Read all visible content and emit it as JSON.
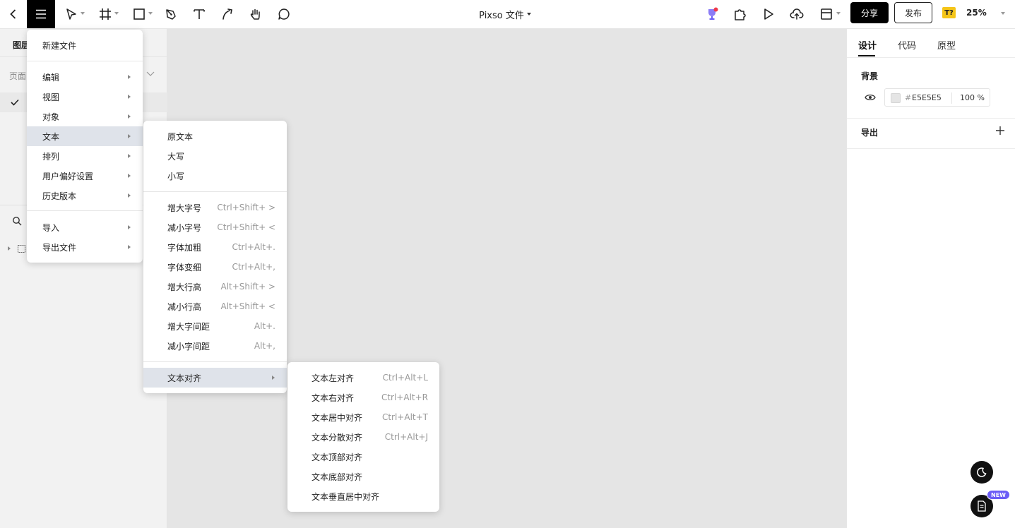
{
  "toolbar": {
    "title": "Pixso 文件",
    "share_label": "分享",
    "publish_label": "发布",
    "font_badge": "T?",
    "zoom": "25%",
    "icons": [
      "back-icon",
      "menu-icon",
      "move-tool-icon",
      "frame-tool-icon",
      "rectangle-tool-icon",
      "pen-tool-icon",
      "text-tool-icon",
      "pencil-tool-icon",
      "hand-tool-icon",
      "comment-tool-icon",
      "trophy-icon",
      "plugin-icon",
      "play-icon",
      "upload-icon",
      "layout-icon"
    ]
  },
  "left_panel": {
    "tab_label": "图层",
    "pages_label": "页面"
  },
  "right_panel": {
    "tabs": [
      {
        "label": "设计",
        "active": true
      },
      {
        "label": "代码",
        "active": false
      },
      {
        "label": "原型",
        "active": false
      }
    ],
    "background_label": "背景",
    "background_hash": "#",
    "background_hex": "E5E5E5",
    "background_opacity": "100 %",
    "export_label": "导出"
  },
  "main_menu": {
    "items": [
      {
        "label": "新建文件",
        "submenu": false
      },
      {
        "label": "编辑",
        "submenu": true
      },
      {
        "label": "视图",
        "submenu": true
      },
      {
        "label": "对象",
        "submenu": true
      },
      {
        "label": "文本",
        "submenu": true,
        "highlighted": true
      },
      {
        "label": "排列",
        "submenu": true
      },
      {
        "label": "用户偏好设置",
        "submenu": true
      },
      {
        "label": "历史版本",
        "submenu": true
      },
      {
        "label": "导入",
        "submenu": true
      },
      {
        "label": "导出文件",
        "submenu": true
      }
    ]
  },
  "text_menu": {
    "items": [
      {
        "label": "原文本",
        "shortcut": ""
      },
      {
        "label": "大写",
        "shortcut": ""
      },
      {
        "label": "小写",
        "shortcut": ""
      },
      {
        "label": "增大字号",
        "shortcut": "Ctrl+Shift+ >"
      },
      {
        "label": "减小字号",
        "shortcut": "Ctrl+Shift+ <"
      },
      {
        "label": "字体加粗",
        "shortcut": "Ctrl+Alt+."
      },
      {
        "label": "字体变细",
        "shortcut": "Ctrl+Alt+,"
      },
      {
        "label": "增大行高",
        "shortcut": "Alt+Shift+ >"
      },
      {
        "label": "减小行高",
        "shortcut": "Alt+Shift+ <"
      },
      {
        "label": "增大字间距",
        "shortcut": "Alt+."
      },
      {
        "label": "减小字间距",
        "shortcut": "Alt+,"
      },
      {
        "label": "文本对齐",
        "shortcut": "",
        "submenu": true,
        "highlighted": true
      }
    ]
  },
  "align_menu": {
    "items": [
      {
        "label": "文本左对齐",
        "shortcut": "Ctrl+Alt+L"
      },
      {
        "label": "文本右对齐",
        "shortcut": "Ctrl+Alt+R"
      },
      {
        "label": "文本居中对齐",
        "shortcut": "Ctrl+Alt+T"
      },
      {
        "label": "文本分散对齐",
        "shortcut": "Ctrl+Alt+J"
      },
      {
        "label": "文本顶部对齐",
        "shortcut": ""
      },
      {
        "label": "文本底部对齐",
        "shortcut": ""
      },
      {
        "label": "文本垂直居中对齐",
        "shortcut": ""
      }
    ]
  },
  "floating": {
    "new_badge": "NEW"
  },
  "colors": {
    "canvas": "#E5E5E5",
    "menu_highlight": "#DFE3EA",
    "accent": "#000000",
    "badge": "#6B5CF6"
  }
}
